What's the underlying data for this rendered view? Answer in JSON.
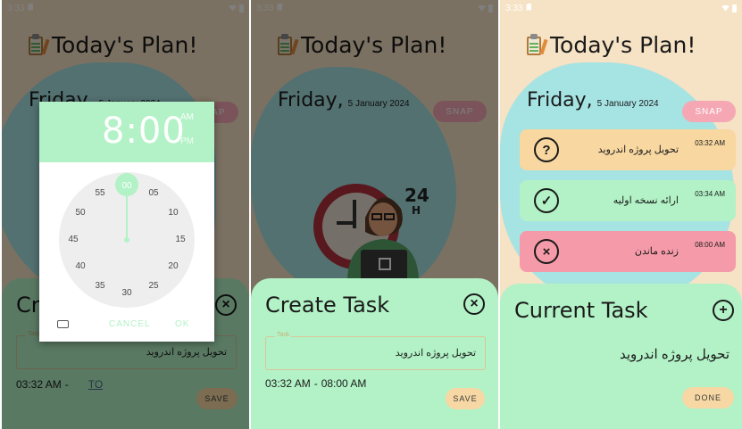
{
  "status_bar": {
    "time": "3:33"
  },
  "app": {
    "title": "Today's Plan!",
    "day": "Friday,",
    "date": "5 January 2024",
    "snap_label": "SNAP"
  },
  "create_task": {
    "title": "Create Task",
    "field_label": "Task",
    "field_value": "تحویل پروژه اندروید",
    "start_time": "03:32 AM",
    "separator": "-",
    "to_label": "TO",
    "end_time": "08:00 AM",
    "save_label": "SAVE"
  },
  "time_picker": {
    "time": "8:00",
    "am": "AM",
    "pm": "PM",
    "minute_labels": [
      "00",
      "05",
      "10",
      "15",
      "20",
      "25",
      "30",
      "35",
      "40",
      "45",
      "50",
      "55"
    ],
    "cancel_label": "CANCEL",
    "ok_label": "OK"
  },
  "tasks": [
    {
      "name": "تحویل پروژه اندروید",
      "time": "03:32 AM",
      "status_icon": "question-icon",
      "color": "#f8d7a1"
    },
    {
      "name": "ارائه نسخه اولیه",
      "time": "03:34 AM",
      "status_icon": "check-icon",
      "color": "#b2f2c6"
    },
    {
      "name": "زنده ماندن",
      "time": "08:00 AM",
      "status_icon": "x-icon",
      "color": "#f59aa8"
    }
  ],
  "current_task": {
    "title": "Current Task",
    "task": "تحویل پروژه اندروید",
    "done_label": "DONE"
  },
  "colors": {
    "background": "#f6e2c4",
    "blob": "#a6e3e3",
    "sheet": "#b2f2c6",
    "snap": "#f5a8b4",
    "button": "#f7d8a4"
  }
}
